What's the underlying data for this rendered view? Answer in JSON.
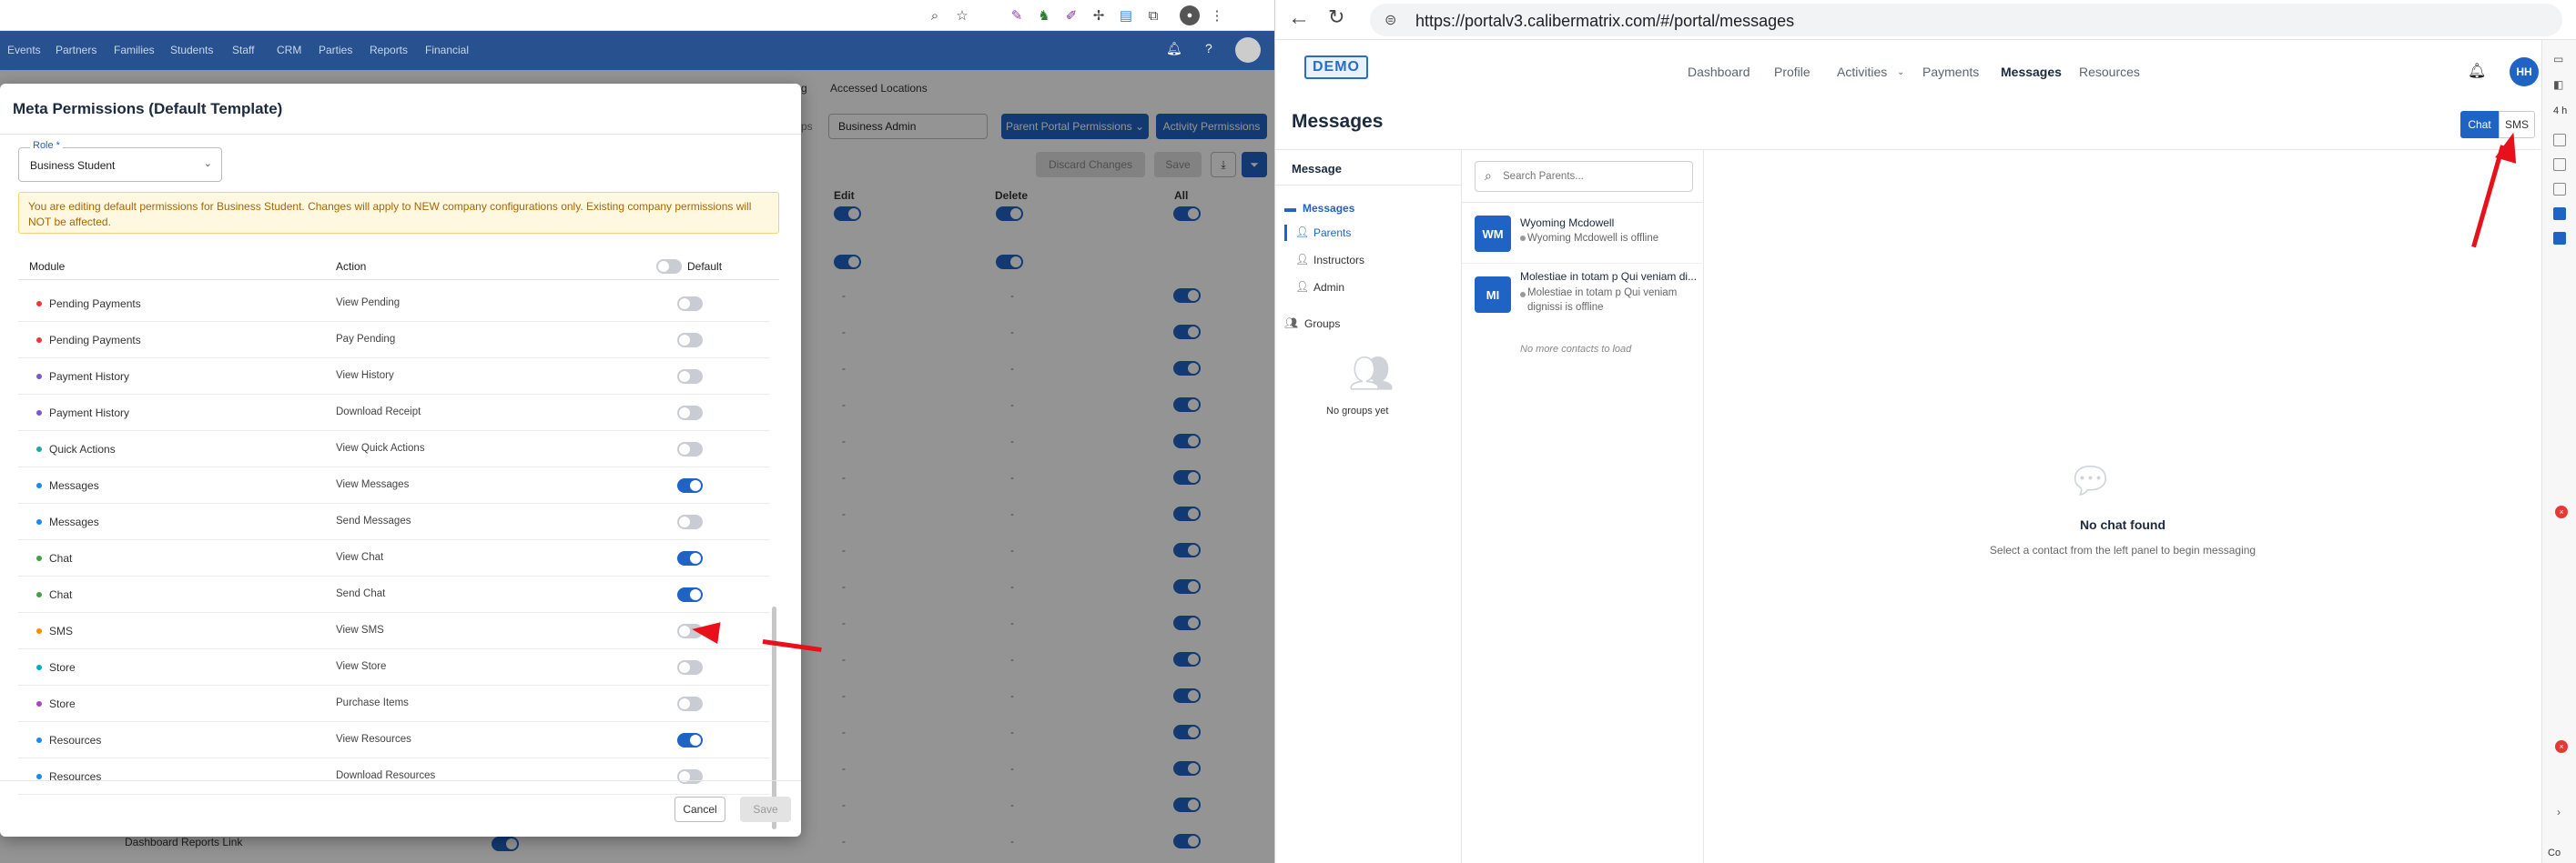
{
  "left_top_nav": [
    "Events",
    "Partners",
    "Families",
    "Students",
    "Staff",
    "CRM",
    "Parties",
    "Reports",
    "Financial"
  ],
  "background_page": {
    "tabs": [
      "g",
      "Accessed Locations"
    ],
    "filter_prefix": "ps",
    "role_filter": "Business Admin",
    "parent_portal_button": "Parent Portal Permissions",
    "activity_permissions_button": "Activity Permissions",
    "discard_button": "Discard Changes",
    "save_button": "Save",
    "columns": [
      "Edit",
      "Delete",
      "All"
    ],
    "dash": "-",
    "last_row_label": "Dashboard Reports Link"
  },
  "modal": {
    "title": "Meta Permissions (Default Template)",
    "role_label": "Role *",
    "role_value": "Business Student",
    "notice": "You are editing default permissions for Business Student. Changes will apply to NEW company configurations only. Existing company permissions will NOT be affected.",
    "col_module": "Module",
    "col_action": "Action",
    "col_default": "Default",
    "rows": [
      {
        "module": "Pending Payments",
        "action": "View Pending",
        "on": false,
        "color": "#e53935"
      },
      {
        "module": "Pending Payments",
        "action": "Pay Pending",
        "on": false,
        "color": "#e53935"
      },
      {
        "module": "Payment History",
        "action": "View History",
        "on": false,
        "color": "#7e57c2"
      },
      {
        "module": "Payment History",
        "action": "Download Receipt",
        "on": false,
        "color": "#7e57c2"
      },
      {
        "module": "Quick Actions",
        "action": "View Quick Actions",
        "on": false,
        "color": "#26a69a"
      },
      {
        "module": "Messages",
        "action": "View Messages",
        "on": true,
        "color": "#1e88e5"
      },
      {
        "module": "Messages",
        "action": "Send Messages",
        "on": false,
        "color": "#1e88e5"
      },
      {
        "module": "Chat",
        "action": "View Chat",
        "on": true,
        "color": "#43a047"
      },
      {
        "module": "Chat",
        "action": "Send Chat",
        "on": true,
        "color": "#43a047"
      },
      {
        "module": "SMS",
        "action": "View SMS",
        "on": false,
        "color": "#fb8c00"
      },
      {
        "module": "Store",
        "action": "View Store",
        "on": false,
        "color": "#00acc1"
      },
      {
        "module": "Store",
        "action": "Purchase Items",
        "on": false,
        "color": "#ab47bc"
      },
      {
        "module": "Resources",
        "action": "View Resources",
        "on": true,
        "color": "#1e88e5"
      },
      {
        "module": "Resources",
        "action": "Download Resources",
        "on": false,
        "color": "#1e88e5"
      }
    ],
    "cancel": "Cancel",
    "save": "Save"
  },
  "browser": {
    "url": "https://portalv3.calibermatrix.com/#/portal/messages"
  },
  "app": {
    "logo": "DEMO",
    "nav": [
      "Dashboard",
      "Profile",
      "Activities",
      "Payments",
      "Messages",
      "Resources"
    ],
    "active_nav": "Messages",
    "avatar": "HH",
    "title": "Messages",
    "chat_btn": "Chat",
    "sms_btn": "SMS",
    "sidebar": {
      "header": "Message",
      "messages": "Messages",
      "parents": "Parents",
      "instructors": "Instructors",
      "admin": "Admin",
      "groups": "Groups",
      "no_groups": "No groups yet"
    },
    "search_placeholder": "Search Parents...",
    "contacts": [
      {
        "initials": "WM",
        "name": "Wyoming Mcdowell",
        "status": "Wyoming Mcdowell is offline"
      },
      {
        "initials": "MI",
        "name": "Molestiae in totam p Qui veniam di...",
        "status": "Molestiae in totam p Qui veniam dignissi is offline"
      }
    ],
    "no_more": "No more contacts to load",
    "empty_title": "No chat found",
    "empty_sub": "Select a contact from the left panel to begin messaging"
  },
  "right_edge_sidebar": {
    "label_top": "4 h",
    "label_bottom": "Co"
  },
  "colors": {
    "primary": "#1f63c4",
    "nav_bg": "#27518f",
    "warning_text": "#a46608",
    "arrow": "#e8101a"
  }
}
